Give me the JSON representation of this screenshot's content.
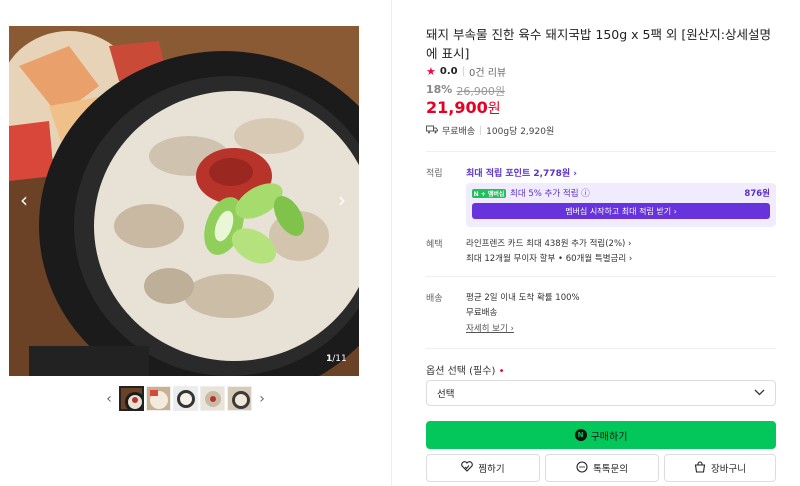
{
  "gallery": {
    "counter_current": "1",
    "counter_total": "/11",
    "prev_label": "‹",
    "next_label": "›"
  },
  "product": {
    "title": "돼지 부속물 진한 육수 돼지국밥 150g x 5팩 외 [원산지:상세설명에 표시]",
    "rating_score": "0.0",
    "review_count": "0건 리뷰",
    "discount": "18%",
    "original_price": "26,900원",
    "price": "21,900",
    "price_unit": "원",
    "shipping": "무료배송",
    "unit_price": "100g당 2,920원"
  },
  "points": {
    "label": "적립",
    "max_link": "최대 적립 포인트 2,778원 ›",
    "np_badge": "N + 멤버십",
    "extra_text": "최대 5% 추가 적립 ⓘ",
    "extra_amount": "876원",
    "member_button": "멤버십 시작하고 최대 적립 받기 ›"
  },
  "benefits": {
    "label": "혜택",
    "line1": "라인프렌즈 카드 최대 438원 추가 적립(2%) ›",
    "line2": "최대 12개월 무이자 할부 • 60개월 특별금리 ›"
  },
  "delivery": {
    "label": "배송",
    "line1": "평균 2일 이내 도착 확률 100%",
    "line2": "무료배송",
    "detail_link": "자세히 보기 ›"
  },
  "options": {
    "label": "옵션 선택 (필수)",
    "required_mark": "•",
    "select_value": "선택"
  },
  "actions": {
    "buy": "구매하기",
    "wish": "찜하기",
    "talk": "톡톡문의",
    "cart": "장바구니"
  },
  "colors": {
    "price_red": "#e60023",
    "purple": "#5a31c9",
    "buy_green": "#03c75a"
  }
}
